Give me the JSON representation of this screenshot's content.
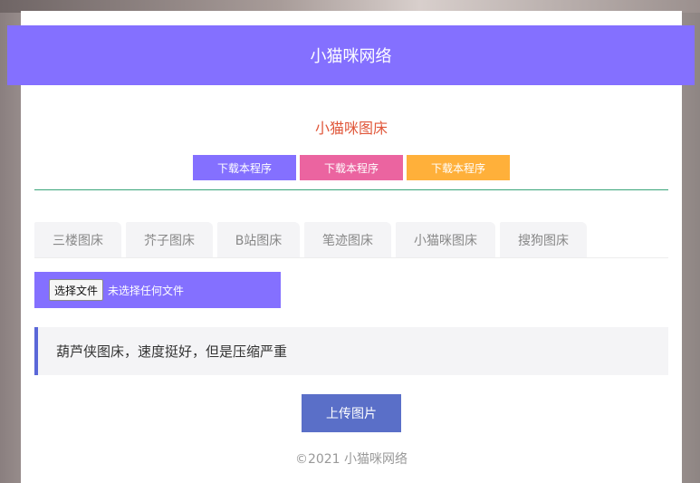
{
  "header": {
    "title": "小猫咪网络"
  },
  "main": {
    "subtitle": "小猫咪图床",
    "download_buttons": [
      {
        "label": "下载本程序",
        "color": "#8470ff"
      },
      {
        "label": "下载本程序",
        "color": "#eb64a0"
      },
      {
        "label": "下载本程序",
        "color": "#ffb03a"
      }
    ],
    "tabs": [
      {
        "label": "三楼图床"
      },
      {
        "label": "芥子图床"
      },
      {
        "label": "B站图床"
      },
      {
        "label": "笔迹图床"
      },
      {
        "label": "小猫咪图床"
      },
      {
        "label": "搜狗图床"
      }
    ],
    "file_input": {
      "button_label": "选择文件",
      "status": "未选择任何文件"
    },
    "notice": "葫芦侠图床，速度挺好，但是压缩严重",
    "upload_label": "上传图片"
  },
  "footer": {
    "text": "©2021 小猫咪网络"
  },
  "colors": {
    "accent": "#8470ff",
    "upload": "#5a6fc8",
    "subtitle": "#e0573a",
    "divider": "#3aa57a"
  }
}
